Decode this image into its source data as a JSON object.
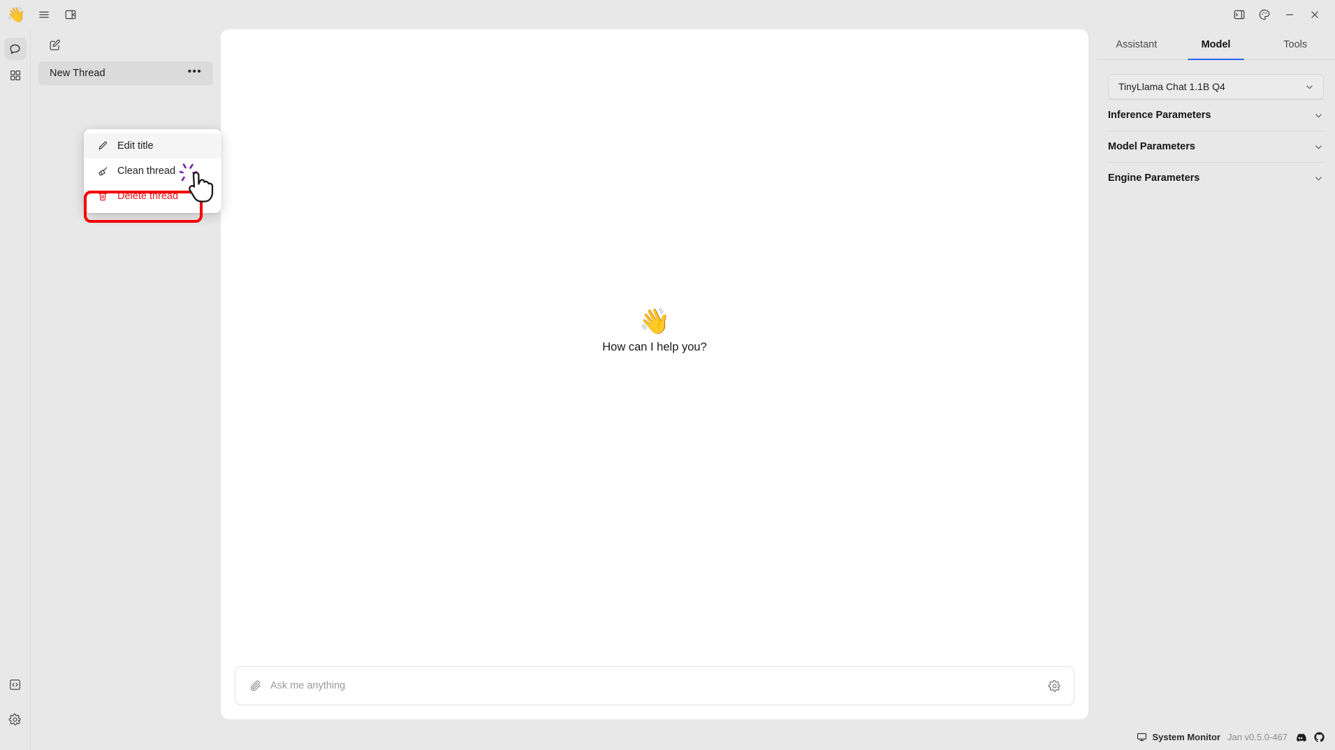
{
  "titlebar": {
    "logo": "waving-hand-logo",
    "left_buttons": [
      {
        "name": "menu-icon",
        "title": "Menu"
      },
      {
        "name": "collapse-left-panel-icon",
        "title": "Toggle left panel"
      }
    ],
    "right_buttons": [
      {
        "name": "collapse-right-panel-icon",
        "title": "Toggle right panel"
      },
      {
        "name": "theme-palette-icon",
        "title": "Theme"
      },
      {
        "name": "minimize-icon",
        "title": "Minimize"
      },
      {
        "name": "close-icon",
        "title": "Close"
      }
    ]
  },
  "rail": {
    "top_items": [
      {
        "name": "chat-icon",
        "label": "Chat",
        "active": true
      },
      {
        "name": "apps-grid-icon",
        "label": "Hub",
        "active": false
      }
    ],
    "bottom_items": [
      {
        "name": "code-brackets-icon",
        "label": "Local API Server",
        "active": false
      },
      {
        "name": "gear-icon",
        "label": "Settings",
        "active": false
      }
    ]
  },
  "sidebar": {
    "new_thread_icon": "compose-new-thread-icon",
    "threads": [
      {
        "title": "New Thread",
        "selected": true,
        "menu_icon": "ellipsis-horizontal-icon"
      }
    ]
  },
  "context_menu": {
    "items": [
      {
        "label": "Edit title",
        "icon": "pencil-icon",
        "danger": false,
        "hovered": true
      },
      {
        "label": "Clean thread",
        "icon": "broom-icon",
        "danger": false,
        "hovered": false
      },
      {
        "label": "Delete thread",
        "icon": "trash-icon",
        "danger": true,
        "hovered": false
      }
    ],
    "highlight_target": "Delete thread",
    "highlight_color": "#F50000",
    "cursor": "pointing-hand-cursor"
  },
  "chat": {
    "wave_emoji": "👋",
    "prompt": "How can I help you?",
    "composer": {
      "attach_icon": "paperclip-icon",
      "placeholder": "Ask me anything",
      "value": "",
      "settings_icon": "gear-icon"
    }
  },
  "right_panel": {
    "tabs": [
      {
        "label": "Assistant",
        "active": false
      },
      {
        "label": "Model",
        "active": true
      },
      {
        "label": "Tools",
        "active": false
      }
    ],
    "model_select": {
      "value": "TinyLlama Chat 1.1B Q4",
      "chevron": "chevron-down-icon"
    },
    "accordions": [
      {
        "label": "Inference Parameters",
        "expanded": false,
        "chevron": "chevron-down-icon"
      },
      {
        "label": "Model Parameters",
        "expanded": false,
        "chevron": "chevron-down-icon"
      },
      {
        "label": "Engine Parameters",
        "expanded": false,
        "chevron": "chevron-down-icon"
      }
    ]
  },
  "statusbar": {
    "system_monitor_label": "System Monitor",
    "system_monitor_icon": "monitor-icon",
    "version": "Jan v0.5.0-467",
    "links": [
      {
        "name": "discord-icon"
      },
      {
        "name": "github-icon"
      }
    ]
  },
  "colors": {
    "app_background": "#E8E8E8",
    "card_background": "#FFFFFF",
    "accent_blue": "#2563EB",
    "danger_red": "#E5121C",
    "highlight_red": "#F50000",
    "selected_item": "#DBDBDB"
  }
}
